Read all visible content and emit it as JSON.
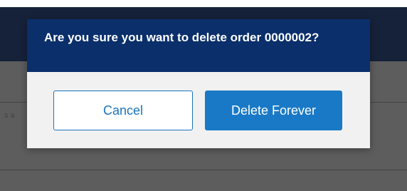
{
  "background": {
    "ghost_text": "s a"
  },
  "dialog": {
    "title": "Are you sure you want to delete order 0000002?",
    "cancel_label": "Cancel",
    "confirm_label": "Delete Forever"
  },
  "colors": {
    "header_bg": "#0a2f6b",
    "primary_button": "#1a79c6",
    "dialog_bg": "#f1f1f1"
  }
}
